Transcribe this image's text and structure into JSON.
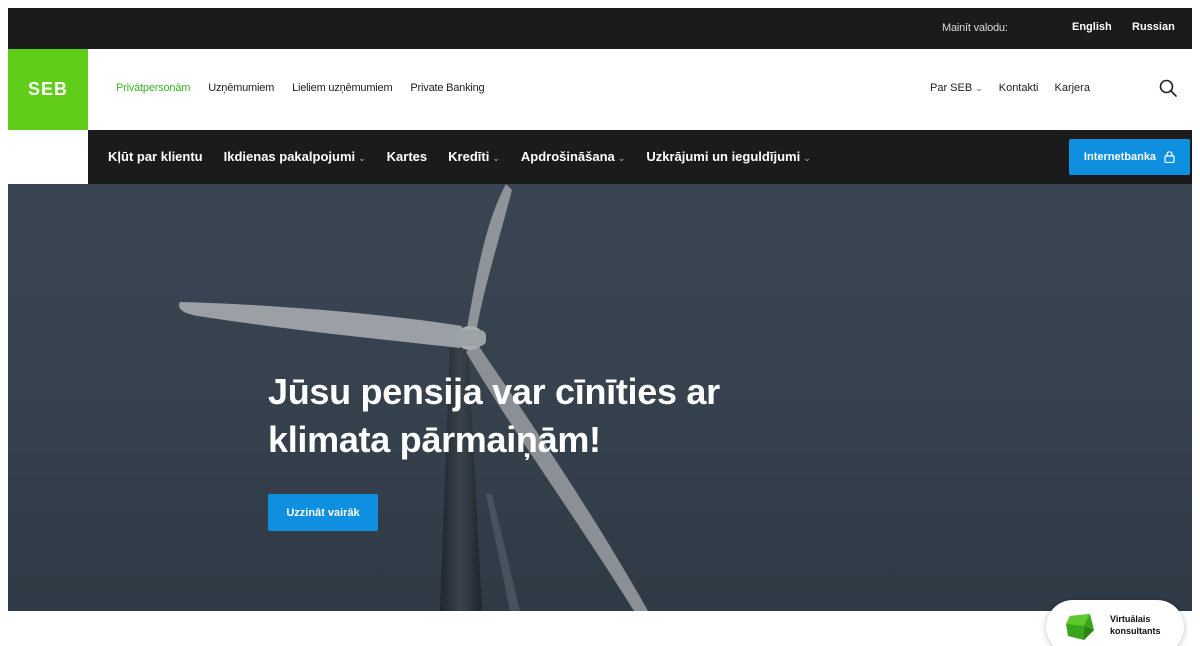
{
  "lang_bar": {
    "label": "Mainīt valodu:",
    "languages": [
      "English",
      "Russian"
    ]
  },
  "logo": {
    "text": "SEB",
    "color": "#60cd18"
  },
  "segments": [
    {
      "label": "Privātpersonām",
      "active": true
    },
    {
      "label": "Uzņēmumiem"
    },
    {
      "label": "Lieliem uzņēmumiem"
    },
    {
      "label": "Private Banking"
    }
  ],
  "top_links": {
    "about": "Par SEB",
    "contacts": "Kontakti",
    "career": "Karjera",
    "search_icon": "search-icon"
  },
  "nav": {
    "items": [
      {
        "label": "Kļūt par klientu"
      },
      {
        "label": "Ikdienas pakalpojumi",
        "dropdown": "⌄"
      },
      {
        "label": "Kartes"
      },
      {
        "label": "Kredīti",
        "dropdown": "⌄"
      },
      {
        "label": "Apdrošināšana",
        "dropdown": "⌄"
      },
      {
        "label": "Uzkrājumi un ieguldījumi",
        "dropdown": "⌄"
      }
    ],
    "internetbank_label": "Internetbanka",
    "internetbank_icon": "lock-icon",
    "accent": "#0e8fe0"
  },
  "hero": {
    "title": "Jūsu pensija var cīnīties ar klimata pārmaiņām!",
    "button": "Uzzināt vairāk"
  },
  "virtual_assistant": {
    "line1": "Virtuālais",
    "line2": "konsultants"
  }
}
